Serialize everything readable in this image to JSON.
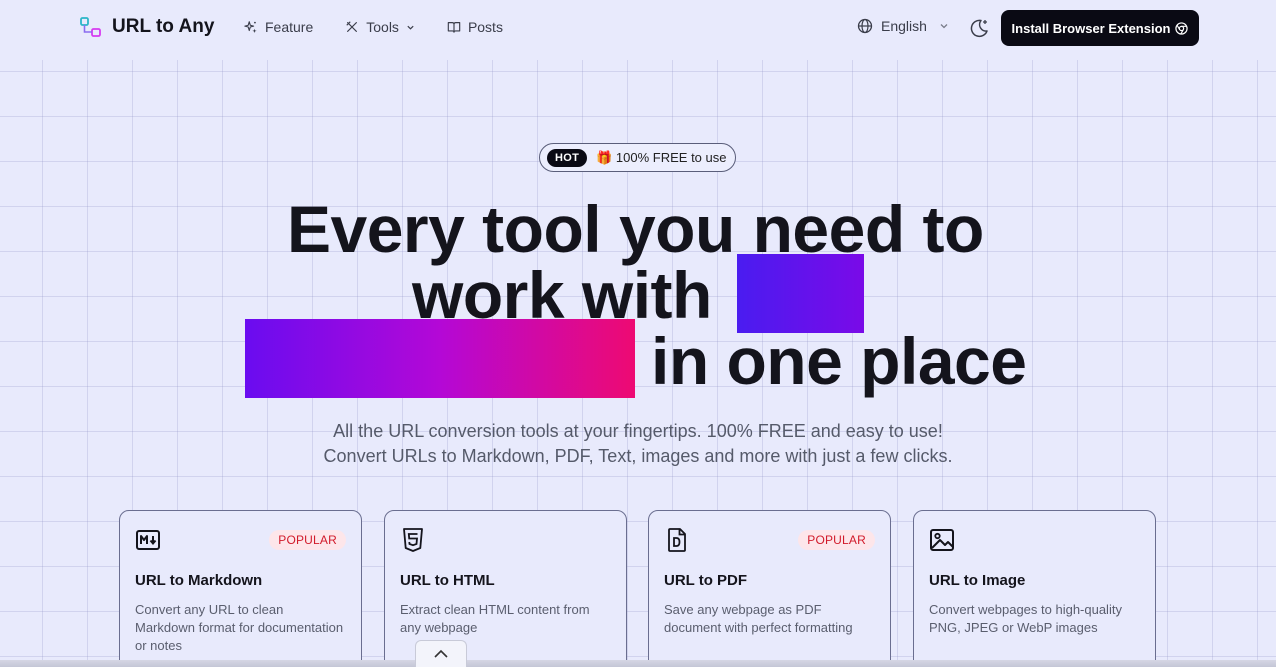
{
  "header": {
    "brand": "URL to Any",
    "nav": [
      {
        "label": "Feature",
        "icon": "sparkles-icon"
      },
      {
        "label": "Tools",
        "icon": "tools-icon"
      },
      {
        "label": "Posts",
        "icon": "book-icon"
      }
    ],
    "language": "English",
    "install_label": "Install Browser Extension"
  },
  "hero": {
    "badge_hot": "HOT",
    "badge_text": "🎁 100% FREE to use",
    "headline_line1": "Every tool you need to",
    "headline_line2": "work with",
    "headline_line3": "in one place",
    "subtitle_line1": "All the URL conversion tools at your fingertips. 100% FREE and easy to use!",
    "subtitle_line2": "Convert URLs to Markdown, PDF, Text, images and more with just a few clicks."
  },
  "cards": [
    {
      "title": "URL to Markdown",
      "desc": "Convert any URL to clean Markdown format for documentation or notes",
      "badge": "POPULAR",
      "icon": "markdown-icon"
    },
    {
      "title": "URL to HTML",
      "desc": "Extract clean HTML content from any webpage",
      "badge": "",
      "icon": "html5-icon"
    },
    {
      "title": "URL to PDF",
      "desc": "Save any webpage as PDF document with perfect formatting",
      "badge": "POPULAR",
      "icon": "pdf-file-icon"
    },
    {
      "title": "URL to Image",
      "desc": "Convert webpages to high-quality PNG, JPEG or WebP images",
      "badge": "",
      "icon": "image-icon"
    }
  ],
  "colors": {
    "accent": "#0a0a14",
    "gradient_start": "#4a1cf0",
    "gradient_end": "#ee0a72",
    "popular": "#d11a2a"
  }
}
